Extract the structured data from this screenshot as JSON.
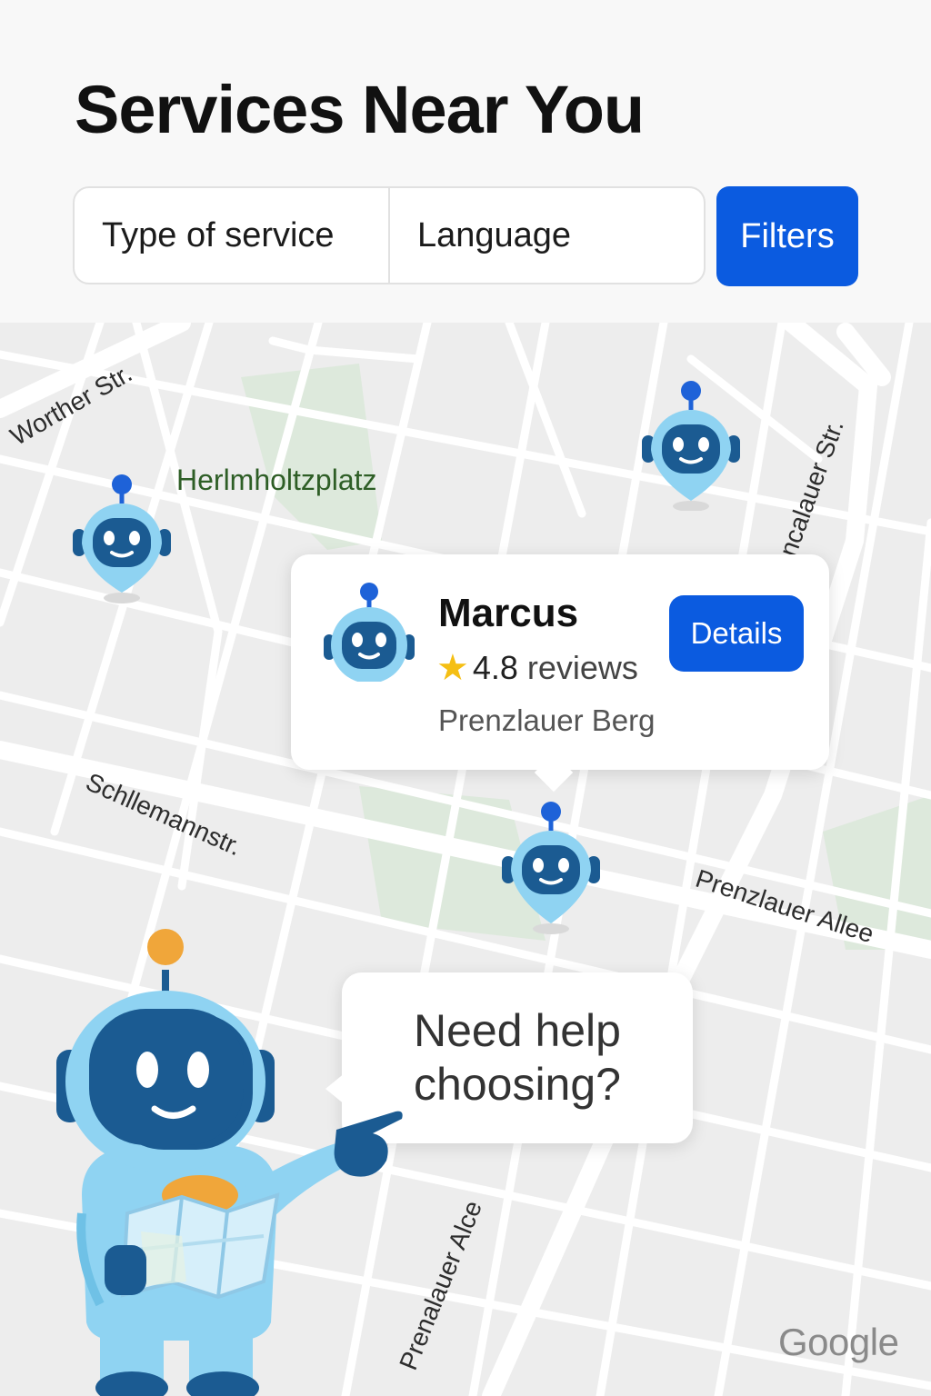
{
  "header": {
    "title": "Services Near You",
    "filters": {
      "service_type_label": "Type of service",
      "language_label": "Language",
      "filters_button_label": "Filters"
    }
  },
  "map": {
    "park_label": "Herlmholtzplatz",
    "streets": [
      "Worther Str.",
      "ncalauer Str.",
      "Schllemannstr.",
      "Prenzlauer Allee",
      "Prenalauer Alce"
    ],
    "attribution": "Google"
  },
  "selected_provider": {
    "name": "Marcus",
    "rating": "4.8",
    "reviews_label": "reviews",
    "neighborhood": "Prenzlauer Berg",
    "details_button_label": "Details"
  },
  "assistant": {
    "prompt": "Need help choosing?"
  },
  "colors": {
    "accent": "#0b5be0",
    "map_background": "#ededed",
    "road": "#ffffff",
    "park": "#dde9dc",
    "robot_light": "#8fd3f2",
    "robot_dark": "#1b5b92",
    "star": "#f5bf14",
    "antenna_orange": "#f0a63a"
  }
}
